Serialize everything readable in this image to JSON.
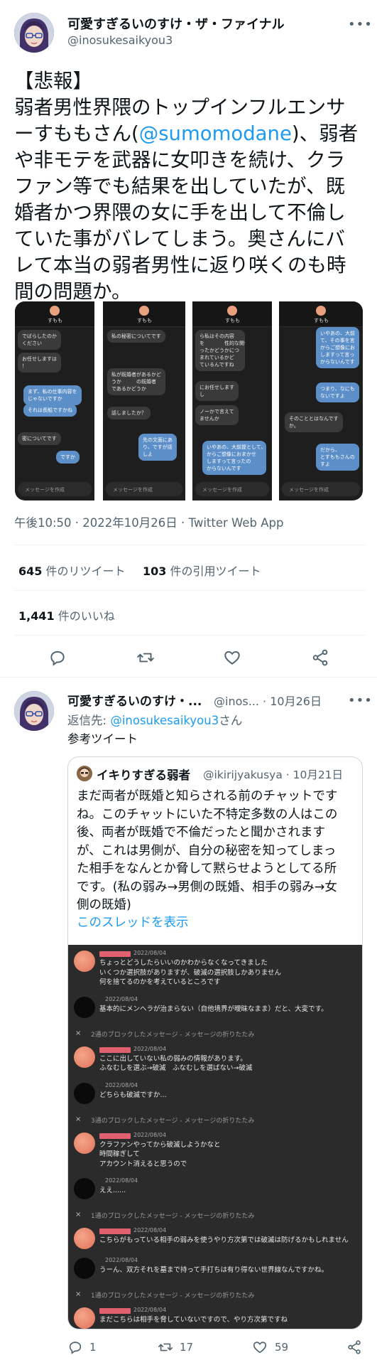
{
  "tweet": {
    "author_name": "可愛すぎるいのすけ・ザ・ファイナル",
    "author_handle": "@inosukesaikyou3",
    "more_icon": "more-horizontal-icon",
    "text_lines": [
      {
        "text": "【悲報】"
      },
      {
        "text": "弱者男性界隈のトップインフルエンサ"
      },
      {
        "pre": "ーすももさん(",
        "mention": "@sumomodane",
        "post": ")、弱者"
      },
      {
        "text": "や非モテを武器に女叩きを続け、クラ"
      },
      {
        "text": "ファン等でも結果を出していたが、既"
      },
      {
        "text": "婚者かつ界隈の女に手を出して不倫し"
      },
      {
        "text": "ていた事がバレてしまう。奥さんにバ"
      },
      {
        "text": "レて本当の弱者男性に返り咲くのも時"
      },
      {
        "text": "間の問題か。"
      }
    ],
    "meta": "午後10:50 · 2022年10月26日 · Twitter Web App",
    "retweets_count": "645",
    "retweets_label": " 件のリツイート",
    "quotes_count": "103",
    "quotes_label": " 件の引用ツイート",
    "likes_count": "1,441",
    "likes_label": " 件のいいね",
    "screenshots": [
      {
        "user": "すもも",
        "gray": [
          "でばらしたのか\nください",
          "お任せしますは\n！"
        ],
        "blue": [
          "まず、私の仕事内容を\nじゃないですか",
          "それは長船ですかね"
        ],
        "gray2": [
          "密についてです"
        ],
        "blue2": [
          "ですか"
        ],
        "input": "メッセージを作成"
      },
      {
        "user": "すもも",
        "gray": [
          "私の秘密についてです",
          "私が既婚者があるかど\nうか　　　の既婚者\nであるかどうか",
          "話しましたか？"
        ],
        "blue": [
          "先の文面にあ\nり、ですが話\nしよ"
        ],
        "input": "メッセージを作成"
      },
      {
        "user": "すもも",
        "gray": [
          "ら私はその内容\nを　　　　性的な関係\nったかどうかにつ\nまれているかど\nているんですね",
          "にお任せします\nし",
          "ノーかで言えて\nませんか"
        ],
        "blue": [
          "いやあの、大前提として、その事を言えない\nからご想像におまかせ\nしますって言ったの\nからないんです"
        ],
        "input": "メッセージを作成"
      },
      {
        "user": "すもも",
        "gray": [
          "そのこととはなんです\nか。"
        ],
        "blue": [
          "いやあの、大前\nて、その事を言\nからご想像にお\nしますって言っ\nからないんです",
          "つまり、なにも\nないですよ",
          "だから、　　　\nとすももさんの\nすよ"
        ],
        "input": "メッセージを作成"
      }
    ]
  },
  "actions": {
    "reply_icon": "reply-icon",
    "retweet_icon": "retweet-icon",
    "like_icon": "heart-icon",
    "share_icon": "share-icon"
  },
  "reply": {
    "author_name": "可愛すぎるいのすけ・...",
    "handle_date": "@inos... · 10月26日",
    "reply_to_label": "返信先: ",
    "reply_to_mention": "@inosukesaikyou3",
    "reply_to_suffix": "さん",
    "body": "参考ツイート",
    "counts": {
      "reply": "1",
      "retweet": "17",
      "like": "59"
    }
  },
  "quote": {
    "author_name": "イキりすぎる弱者",
    "handle_date": "@ikirijyakusya · 10月21日",
    "text_lines": [
      "まだ両者が既婚と知らされる前のチャットです",
      "ね。このチャットにいた不特定多数の人はこの",
      "後、両者が既婚で不倫だったと聞かされます",
      "が、これは男側が、自分の秘密を知ってしまっ",
      "た相手をなんとか脅して黙らせようとしてる所",
      "です。(私の弱み→男側の既婚、相手の弱み→女",
      "側の既婚)"
    ],
    "show_thread": "このスレッドを表示",
    "chat": [
      {
        "kind": "msg",
        "avatar": "peach",
        "date": "2022/08/04",
        "text": "ちょっとどうしたらいいのかわからなくなってきました\nいくつか選択肢がありますが、破滅の選択肢しかありません\n何を捨てるのかを考えているところです"
      },
      {
        "kind": "msg",
        "avatar": "black",
        "date": "2022/08/04",
        "text": "基本的にメンヘラが治まらない（自他境界が曖昧なまま）だと、大変です。"
      },
      {
        "kind": "blocked",
        "text": "2通のブロックしたメッセージ - メッセージの折りたたみ"
      },
      {
        "kind": "msg",
        "avatar": "peach",
        "date": "2022/08/04",
        "text": "ここに出していない私の弱みの情報があります。\nふなむしを選ぶ→破滅　ふなむしを選ばない→破滅"
      },
      {
        "kind": "msg",
        "avatar": "black",
        "date": "2022/08/04",
        "text": "どちらも破滅ですか..."
      },
      {
        "kind": "blocked",
        "text": "3通のブロックしたメッセージ - メッセージの折りたたみ"
      },
      {
        "kind": "msg",
        "avatar": "peach",
        "date": "2022/08/04",
        "text": "クラファンやってから破滅しようかなと\n時間稼ぎして\nアカウント消えると思うので"
      },
      {
        "kind": "msg",
        "avatar": "black",
        "date": "2022/08/04",
        "text": "ええ......"
      },
      {
        "kind": "blocked",
        "text": "1通のブロックしたメッセージ - メッセージの折りたたみ"
      },
      {
        "kind": "msg",
        "avatar": "peach",
        "date": "2022/08/04",
        "text": "こちらがもっている相手の弱みを使うやり方次第では破滅は防げるかもしれません"
      },
      {
        "kind": "msg",
        "avatar": "black",
        "date": "2022/08/04",
        "text": "うーん、双方それを墓まで持って手打ちは有り得ない世界線なんですかね。"
      },
      {
        "kind": "blocked",
        "text": "1通のブロックしたメッセージ - メッセージの折りたたみ"
      },
      {
        "kind": "msg",
        "avatar": "peach",
        "date": "2022/08/04",
        "text": "まだこちらは相手を脅していないですので、やり方次第ですね"
      }
    ]
  },
  "colors": {
    "accent": "#1d9bf0",
    "text": "#0f1419",
    "muted": "#536471"
  }
}
